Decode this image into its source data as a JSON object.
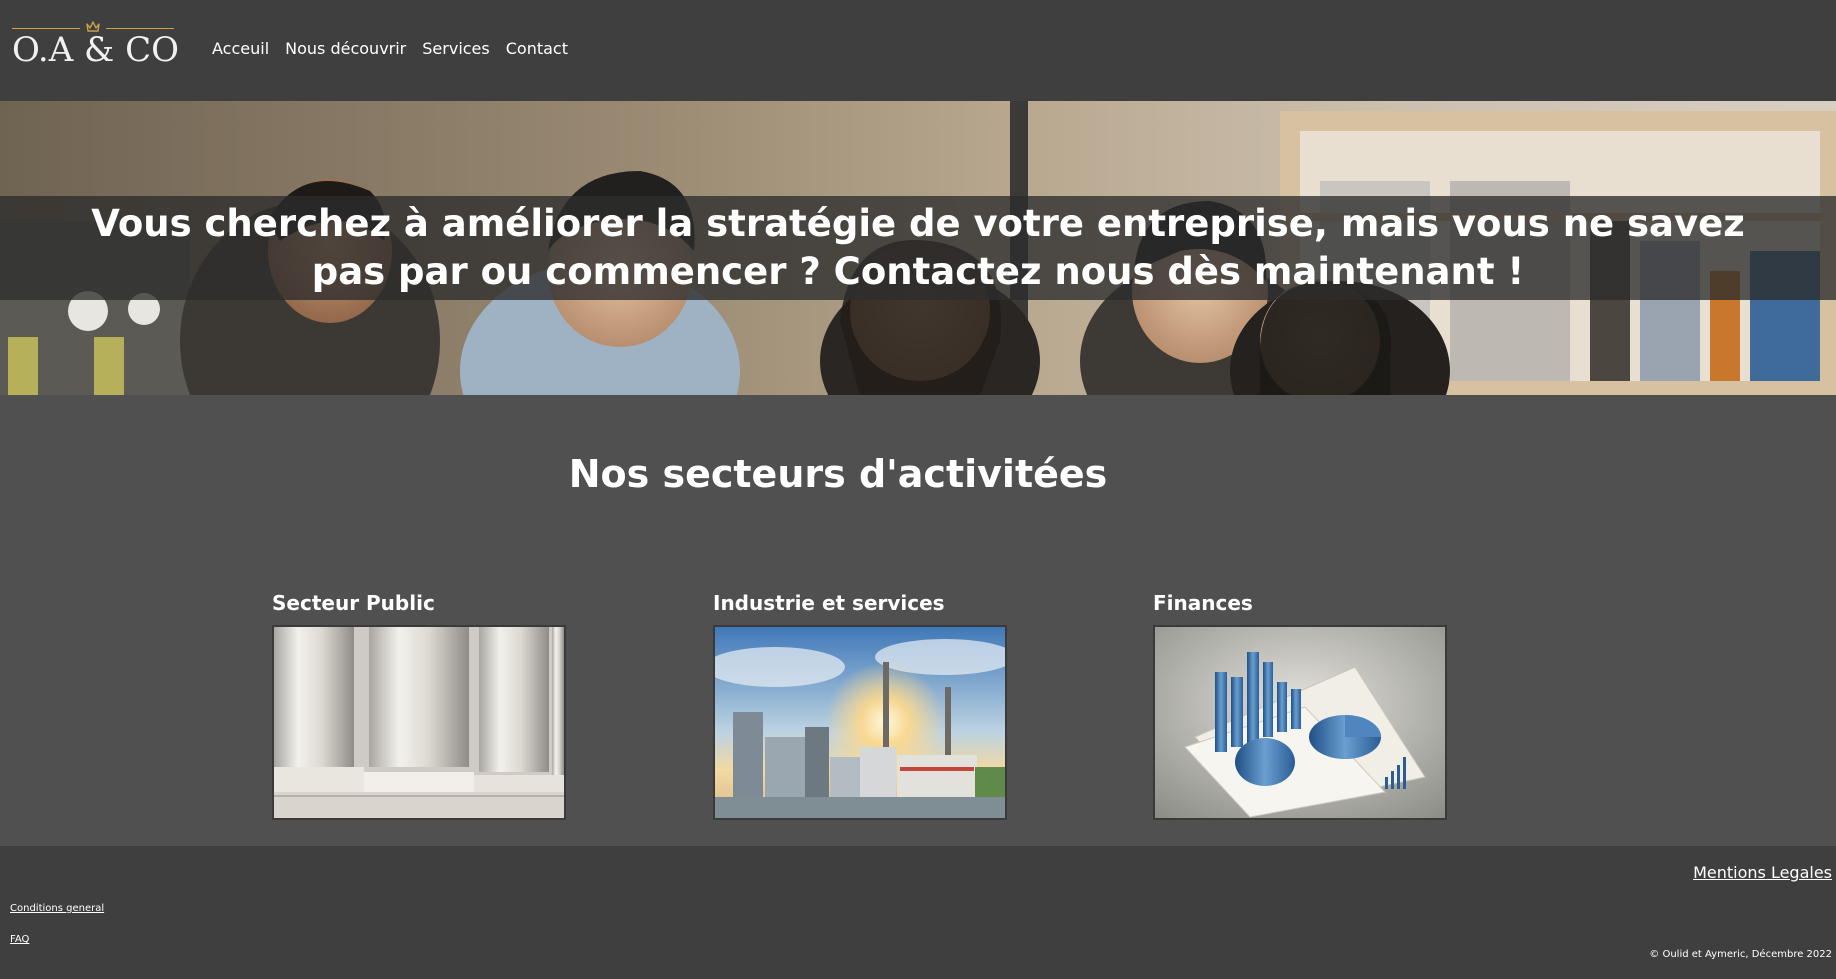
{
  "header": {
    "logo_text": "O.A & CO",
    "nav": [
      {
        "label": "Acceuil"
      },
      {
        "label": "Nous découvrir"
      },
      {
        "label": "Services"
      },
      {
        "label": "Contact"
      }
    ]
  },
  "hero": {
    "text": "Vous cherchez à améliorer la stratégie de votre entreprise, mais vous ne savez pas par ou commencer ? Contactez nous dès maintenant !"
  },
  "sectors": {
    "title": "Nos secteurs d'activitées",
    "items": [
      {
        "label": "Secteur Public"
      },
      {
        "label": "Industrie et services"
      },
      {
        "label": "Finances"
      }
    ]
  },
  "footer": {
    "mentions": "Mentions Legales",
    "conditions": "Conditions general",
    "faq": "FAQ",
    "copyright": "© Oulid et Aymeric, Décembre 2022"
  },
  "colors": {
    "header_bg": "#3f3f3f",
    "body_bg": "#505050",
    "logo_gold": "#c9a24a"
  }
}
